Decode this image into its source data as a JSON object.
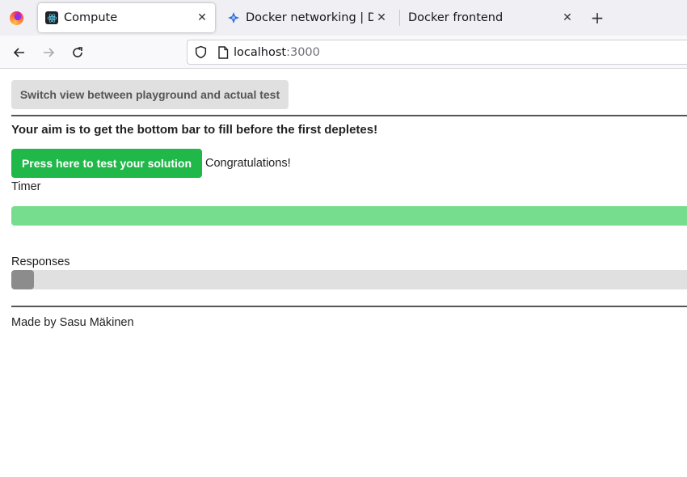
{
  "browser": {
    "tabs": [
      {
        "title": "Compute",
        "icon": "react-icon",
        "active": true
      },
      {
        "title": "Docker networking | DevOps",
        "icon": "docker-icon",
        "active": false
      },
      {
        "title": "Docker frontend",
        "icon": "none",
        "active": false
      }
    ],
    "address": {
      "host": "localhost",
      "port": ":3000"
    }
  },
  "page": {
    "switch_label": "Switch view between playground and actual test",
    "aim_text": "Your aim is to get the bottom bar to fill before the first depletes!",
    "test_label": "Press here to test your solution",
    "result_text": "Congratulations!",
    "timer_label": "Timer",
    "timer_progress": 1.0,
    "responses_label": "Responses",
    "responses_progress": 0.033,
    "footer": "Made by Sasu Mäkinen"
  },
  "colors": {
    "test_button": "#21b84a",
    "timer_bar": "#77dd8e",
    "responses_bar": "#8c8c8c",
    "track": "#e0e0e0"
  }
}
